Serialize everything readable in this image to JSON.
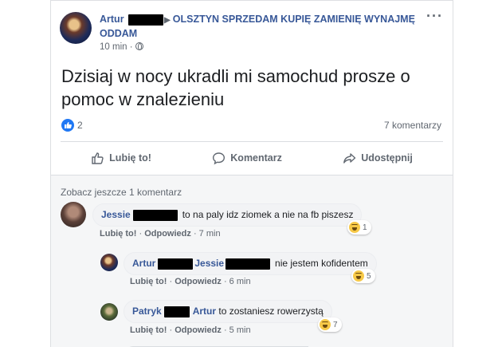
{
  "post": {
    "author": "Artur",
    "group": "OLSZTYN SPRZEDAM KUPIĘ ZAMIENIĘ WYNAJMĘ ODDAM",
    "time": "10 min ·",
    "text": "Dzisiaj w nocy ukradli mi samochud prosze o pomoc w znalezieniu",
    "likes": "2",
    "comments_count": "7 komentarzy",
    "more_icon": "more-horizontal-icon",
    "privacy_icon": "globe-icon"
  },
  "actions": {
    "like": "Lubię to!",
    "comment": "Komentarz",
    "share": "Udostępnij"
  },
  "comments": {
    "see_more": "Zobacz jeszcze 1 komentarz",
    "items": [
      {
        "name": "Jessie",
        "text": "to na paly idz ziomek a nie na fb piszesz",
        "like": "Lubię to!",
        "sep1": " · ",
        "reply": "Odpowiedz",
        "time": " · 7 min",
        "reactions": "1"
      },
      {
        "name": "Artur",
        "tag": "Jessie",
        "text": "nie jestem kofidentem",
        "like": "Lubię to!",
        "sep1": " · ",
        "reply": "Odpowiedz",
        "time": " · 6 min",
        "reactions": "5"
      },
      {
        "name": "Patryk",
        "tag": "Artur",
        "text": "to zostaniesz rowerzystą",
        "like": "Lubię to!",
        "sep1": " · ",
        "reply": "Odpowiedz",
        "time": " · 5 min",
        "reactions": "7"
      }
    ]
  },
  "colors": {
    "link": "#385898",
    "like_blue": "#2078f4",
    "haha_yellow": "#f7c948",
    "redaction": "#000000"
  }
}
